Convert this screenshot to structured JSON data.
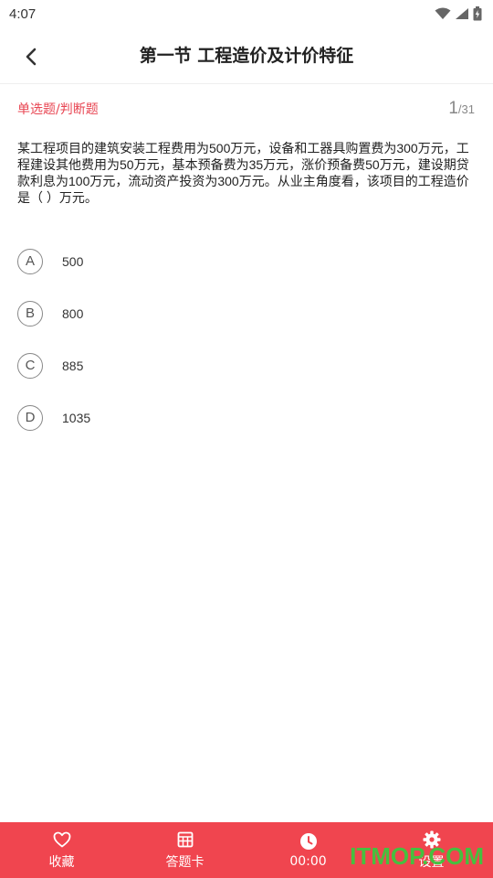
{
  "status_bar": {
    "time": "4:07"
  },
  "header": {
    "title": "第一节 工程造价及计价特征",
    "back_icon": "chevron-left-icon"
  },
  "question": {
    "type_label": "单选题/判断题",
    "current": "1",
    "total": "/31",
    "text": "某工程项目的建筑安装工程费用为500万元，设备和工器具购置费为300万元，工程建设其他费用为50万元，基本预备费为35万元，涨价预备费50万元，建设期贷款利息为100万元，流动资产投资为300万元。从业主角度看，该项目的工程造价是（ ）万元。",
    "options": [
      {
        "letter": "A",
        "text": "500"
      },
      {
        "letter": "B",
        "text": "800"
      },
      {
        "letter": "C",
        "text": "885"
      },
      {
        "letter": "D",
        "text": "1035"
      }
    ]
  },
  "bottom_bar": {
    "color": "#f0454f",
    "items": [
      {
        "label": "收藏",
        "icon": "heart-icon"
      },
      {
        "label": "答题卡",
        "icon": "grid-card-icon"
      },
      {
        "label": "00:00",
        "icon": "clock-icon"
      },
      {
        "label": "设置",
        "icon": "gear-icon"
      }
    ]
  },
  "watermark": "ITMOP.COM"
}
